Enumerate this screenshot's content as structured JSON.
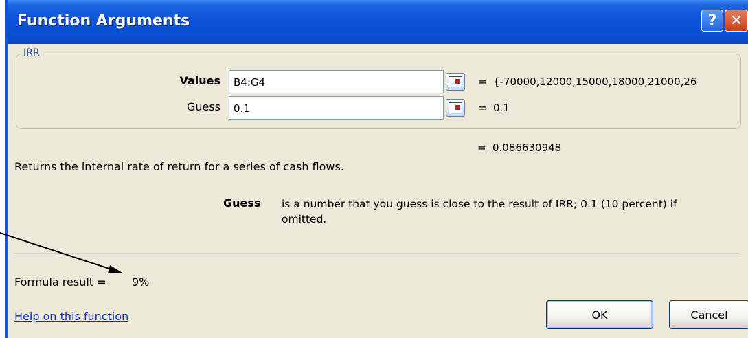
{
  "window": {
    "title": "Function Arguments",
    "help_symbol": "?",
    "close_symbol": "✕"
  },
  "function_group": {
    "legend": "IRR",
    "arguments": [
      {
        "label": "Values",
        "value": "B4:G4",
        "evaluated": "{-70000,12000,15000,18000,21000,26"
      },
      {
        "label": "Guess",
        "value": "0.1",
        "evaluated": "0.1"
      }
    ],
    "equals_sign": "="
  },
  "result_preview": "0.086630948",
  "description": "Returns the internal rate of return for a series of cash flows.",
  "argument_help": {
    "name": "Guess",
    "text": "is a number that you guess is close to the result of IRR; 0.1 (10 percent) if omitted."
  },
  "formula_result": {
    "label": "Formula result =",
    "value": "9%"
  },
  "help_link": "Help on this function",
  "buttons": {
    "ok": "OK",
    "cancel": "Cancel"
  }
}
